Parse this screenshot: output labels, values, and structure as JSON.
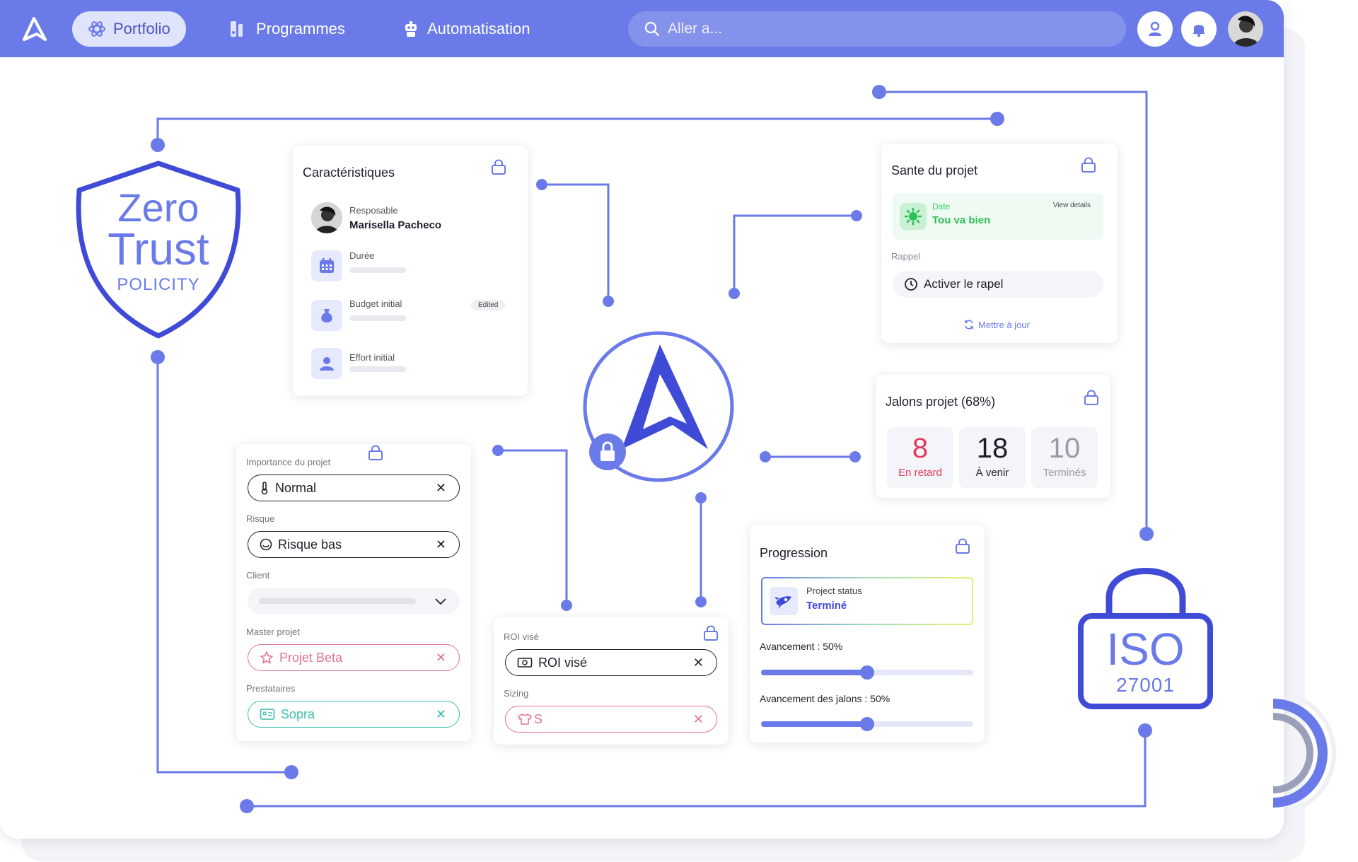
{
  "nav": {
    "items": [
      {
        "label": "Portfolio",
        "icon": "atom-icon",
        "active": true
      },
      {
        "label": "Programmes",
        "icon": "programs-icon",
        "active": false
      },
      {
        "label": "Automatisation",
        "icon": "robot-icon",
        "active": false
      }
    ],
    "search_placeholder": "Aller a..."
  },
  "badges": {
    "zero_trust": {
      "line1": "Zero",
      "line2": "Trust",
      "line3": "POLICITY"
    },
    "iso": {
      "line1": "ISO",
      "line2": "27001"
    }
  },
  "characteristics": {
    "title": "Caractéristiques",
    "responsible_label": "Resposable",
    "responsible_name": "Marisella Pacheco",
    "duration_label": "Durée",
    "budget_label": "Budget initial",
    "budget_badge": "Edited",
    "effort_label": "Effort initial"
  },
  "health": {
    "title": "Sante du projet",
    "date_label": "Date",
    "status": "Tou va bien",
    "view_details": "View details",
    "reminder_label": "Rappel",
    "reminder_button": "Activer le rapel",
    "update_link": "Mettre à jour"
  },
  "milestones": {
    "title": "Jalons projet (68%)",
    "stats": [
      {
        "value": "8",
        "label": "En retard",
        "color": "#e5385f"
      },
      {
        "value": "18",
        "label": "À venir",
        "color": "#1e1e2a"
      },
      {
        "value": "10",
        "label": "Terminés",
        "color": "#9a9aa8"
      }
    ]
  },
  "importance": {
    "importance_label": "Importance du projet",
    "importance_value": "Normal",
    "risk_label": "Risque",
    "risk_value": "Risque bas",
    "client_label": "Client",
    "master_label": "Master projet",
    "master_value": "Projet Beta",
    "providers_label": "Prestataires",
    "providers_value": "Sopra"
  },
  "roi": {
    "roi_label": "ROI visé",
    "roi_value": "ROI visé",
    "sizing_label": "Sizing",
    "sizing_value": "S"
  },
  "progression": {
    "title": "Progression",
    "status_label": "Project status",
    "status_value": "Terminé",
    "advancement_label": "Avancement : 50%",
    "advancement_value": 0.5,
    "milestones_label": "Avancement des jalons : 50%",
    "milestones_value": 0.5
  },
  "colors": {
    "accent": "#6a7ae8",
    "brand_blue": "#3f4bd6",
    "danger": "#e5385f",
    "success": "#3ccf6a",
    "pink": "#e0738f",
    "teal": "#3dbfb0"
  }
}
